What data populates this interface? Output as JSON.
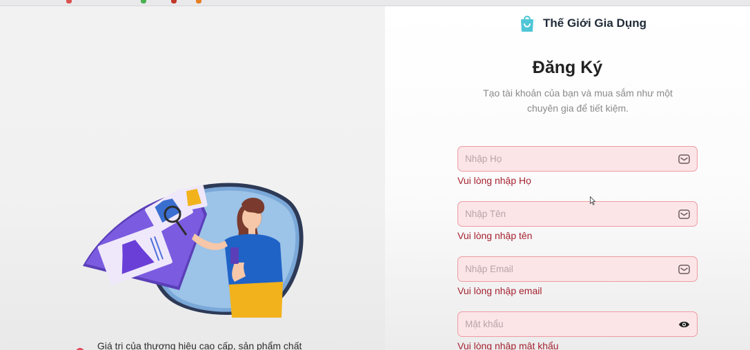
{
  "brand": {
    "name": "Thế Giới Gia Dụng",
    "icon": "shopping-bag-icon",
    "accent_color": "#4fc6d6"
  },
  "form": {
    "title": "Đăng Ký",
    "subtitle": "Tạo tài khoản của bạn và mua sắm như một chuyên gia để tiết kiệm.",
    "fields": [
      {
        "placeholder": "Nhập Họ",
        "value": "",
        "icon": "mail-icon",
        "error": "Vui lòng nhập Họ"
      },
      {
        "placeholder": "Nhập Tên",
        "value": "",
        "icon": "mail-icon",
        "error": "Vui lòng nhập tên"
      },
      {
        "placeholder": "Nhập Email",
        "value": "",
        "icon": "mail-icon",
        "error": "Vui lòng nhập email"
      },
      {
        "placeholder": "Mật khẩu",
        "value": "",
        "icon": "eye-icon",
        "error": "Vui lòng nhập mật khẩu"
      }
    ],
    "error_color": "#a52230",
    "field_background": "#fbe5e7"
  },
  "promo": {
    "text": "Giá trị của thương hiệu cao cấp, sản phẩm chất",
    "illustration": "woman-shopping-illustration"
  }
}
